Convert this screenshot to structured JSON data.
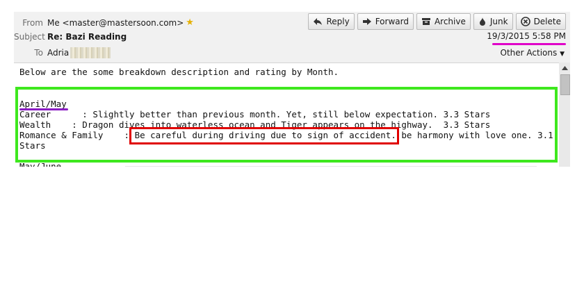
{
  "header": {
    "from_label": "From",
    "from_value": "Me <master@mastersoon.com>",
    "subject_label": "Subject",
    "subject_value": "Re: Bazi Reading",
    "to_label": "To",
    "to_value": "Adria",
    "date": "19/3/2015 5:58 PM",
    "other_actions": "Other Actions"
  },
  "toolbar": [
    {
      "label": "Reply",
      "icon": "reply-icon"
    },
    {
      "label": "Forward",
      "icon": "forward-icon"
    },
    {
      "label": "Archive",
      "icon": "archive-icon"
    },
    {
      "label": "Junk",
      "icon": "junk-icon"
    },
    {
      "label": "Delete",
      "icon": "delete-icon"
    }
  ],
  "body": {
    "intro": "Below are the some breakdown description and rating by Month.",
    "section_title": "April/May",
    "career": "Career      : Slightly better than previous month. Yet, still below expectation. 3.3 Stars",
    "wealth": "Wealth    : Dragon dives into waterless ocean and Tiger appears on the highway.  3.3 Stars",
    "romance_prefix": "Romance & Family    : ",
    "romance_highlight": "Be careful during driving due to sign of accident.",
    "romance_suffix": " be harmony with love one. 3.1",
    "romance_wrap": "Stars",
    "next_section": "May/June"
  },
  "annotations": {
    "green_box_color": "#3ee81e",
    "red_box_color": "#e00000",
    "purple_underline_color": "#8b1cc4",
    "magenta_underline_color": "#e000c8"
  }
}
